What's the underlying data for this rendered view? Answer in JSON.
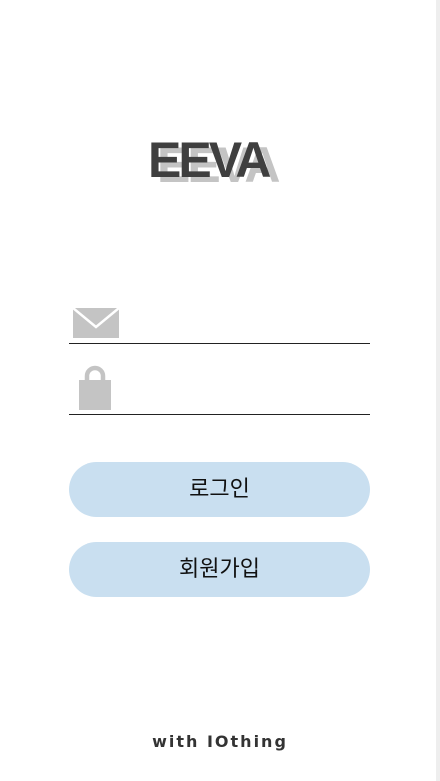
{
  "logo": {
    "text": "EEVA"
  },
  "email_field": {
    "icon": "envelope-icon",
    "value": "",
    "placeholder": ""
  },
  "password_field": {
    "icon": "lock-icon",
    "value": "",
    "placeholder": ""
  },
  "buttons": {
    "login_label": "로그인",
    "signup_label": "회원가입"
  },
  "footer": {
    "text": "with IOthing"
  },
  "colors": {
    "background": "#ffffff",
    "button_fill": "#c9dff0",
    "icon_gray": "#c4c4c4",
    "logo_dark": "#3f3f3f",
    "logo_shadow": "#c4c4c4",
    "underline": "#222222"
  }
}
